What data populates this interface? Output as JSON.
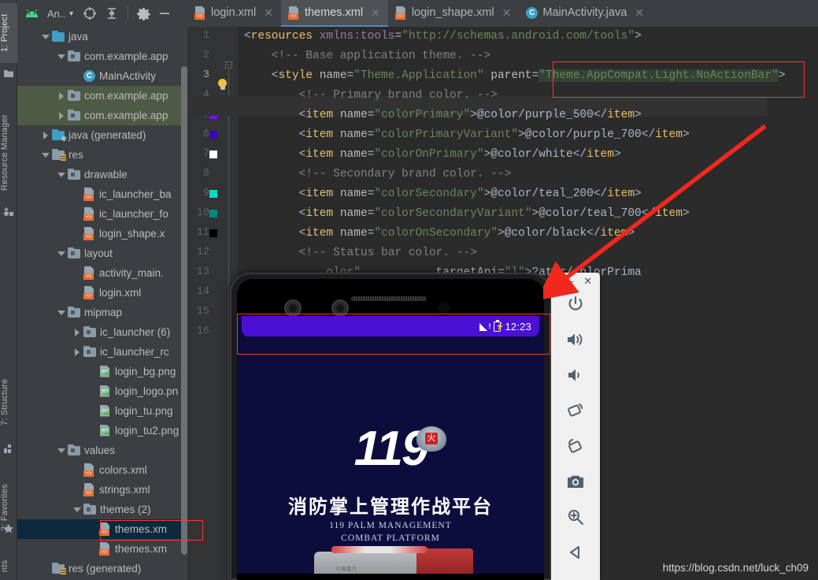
{
  "toolbar": {
    "app_selector": "An..",
    "icons": [
      "android-logo-icon",
      "dropdown-caret-icon",
      "target-icon",
      "collapse-icon",
      "settings-gear-icon",
      "minimize-icon"
    ]
  },
  "tabs": [
    {
      "label": "login.xml",
      "icon": "xml-file-icon",
      "active": false
    },
    {
      "label": "themes.xml",
      "icon": "xml-file-icon",
      "active": true
    },
    {
      "label": "login_shape.xml",
      "icon": "xml-file-icon",
      "active": false
    },
    {
      "label": "MainActivity.java",
      "icon": "java-class-icon",
      "active": false
    }
  ],
  "left_tool_strip": [
    {
      "label": "1: Project",
      "icon": "project-folder-icon",
      "active": true
    },
    {
      "label": "Resource Manager",
      "icon": "resource-manager-icon",
      "active": false
    },
    {
      "label": "7: Structure",
      "icon": "structure-icon",
      "active": false
    },
    {
      "label": "2: Favorites",
      "icon": "star-icon",
      "active": false
    },
    {
      "label": "nts",
      "icon": "",
      "active": false
    }
  ],
  "project_tree": [
    {
      "label": "java",
      "indent": 1,
      "arrow": "down",
      "icon": "folder-blue",
      "type": "folder",
      "state": "normal"
    },
    {
      "label": "com.example.app",
      "indent": 2,
      "arrow": "down",
      "icon": "folder-package",
      "type": "folder",
      "state": "normal"
    },
    {
      "label": "MainActivity",
      "indent": 3,
      "arrow": "none",
      "icon": "java-class-icon",
      "type": "class",
      "state": "normal"
    },
    {
      "label": "com.example.app",
      "indent": 2,
      "arrow": "right",
      "icon": "folder-package",
      "type": "folder",
      "state": "green"
    },
    {
      "label": "com.example.app",
      "indent": 2,
      "arrow": "right",
      "icon": "folder-package",
      "type": "folder",
      "state": "green"
    },
    {
      "label": "java (generated)",
      "indent": 1,
      "arrow": "right",
      "icon": "folder-generated",
      "type": "folder",
      "state": "normal"
    },
    {
      "label": "res",
      "indent": 1,
      "arrow": "down",
      "icon": "folder-res",
      "type": "folder",
      "state": "normal"
    },
    {
      "label": "drawable",
      "indent": 2,
      "arrow": "down",
      "icon": "folder-package",
      "type": "folder",
      "state": "normal"
    },
    {
      "label": "ic_launcher_ba",
      "indent": 3,
      "arrow": "none",
      "icon": "xml-file-icon",
      "type": "xml",
      "state": "normal"
    },
    {
      "label": "ic_launcher_fo",
      "indent": 3,
      "arrow": "none",
      "icon": "xml-file-icon",
      "type": "xml",
      "state": "normal"
    },
    {
      "label": "login_shape.x",
      "indent": 3,
      "arrow": "none",
      "icon": "xml-file-icon",
      "type": "xml",
      "state": "normal"
    },
    {
      "label": "layout",
      "indent": 2,
      "arrow": "down",
      "icon": "folder-package",
      "type": "folder",
      "state": "normal"
    },
    {
      "label": "activity_main.",
      "indent": 3,
      "arrow": "none",
      "icon": "xml-file-icon",
      "type": "xml",
      "state": "normal"
    },
    {
      "label": "login.xml",
      "indent": 3,
      "arrow": "none",
      "icon": "xml-file-icon",
      "type": "xml",
      "state": "normal"
    },
    {
      "label": "mipmap",
      "indent": 2,
      "arrow": "down",
      "icon": "folder-package",
      "type": "folder",
      "state": "normal"
    },
    {
      "label": "ic_launcher (6)",
      "indent": 3,
      "arrow": "right",
      "icon": "folder-package",
      "type": "folder",
      "state": "normal"
    },
    {
      "label": "ic_launcher_rc",
      "indent": 3,
      "arrow": "right",
      "icon": "folder-package",
      "type": "folder",
      "state": "normal"
    },
    {
      "label": "login_bg.png",
      "indent": 4,
      "arrow": "none",
      "icon": "image-file-icon",
      "type": "img",
      "state": "normal"
    },
    {
      "label": "login_logo.pn",
      "indent": 4,
      "arrow": "none",
      "icon": "image-file-icon",
      "type": "img",
      "state": "normal"
    },
    {
      "label": "login_tu.png",
      "indent": 4,
      "arrow": "none",
      "icon": "image-file-icon",
      "type": "img",
      "state": "normal"
    },
    {
      "label": "login_tu2.png",
      "indent": 4,
      "arrow": "none",
      "icon": "image-file-icon",
      "type": "img",
      "state": "normal"
    },
    {
      "label": "values",
      "indent": 2,
      "arrow": "down",
      "icon": "folder-package",
      "type": "folder",
      "state": "normal"
    },
    {
      "label": "colors.xml",
      "indent": 3,
      "arrow": "none",
      "icon": "xml-file-icon",
      "type": "xml",
      "state": "normal"
    },
    {
      "label": "strings.xml",
      "indent": 3,
      "arrow": "none",
      "icon": "xml-file-icon",
      "type": "xml",
      "state": "normal"
    },
    {
      "label": "themes (2)",
      "indent": 3,
      "arrow": "down",
      "icon": "folder-package",
      "type": "folder",
      "state": "normal"
    },
    {
      "label": "themes.xm",
      "indent": 4,
      "arrow": "none",
      "icon": "xml-file-icon",
      "type": "xml",
      "state": "blue"
    },
    {
      "label": "themes.xm",
      "indent": 4,
      "arrow": "none",
      "icon": "xml-file-icon",
      "type": "xml",
      "state": "normal"
    },
    {
      "label": "res (generated)",
      "indent": 1,
      "arrow": "none",
      "icon": "folder-res",
      "type": "folder",
      "state": "normal"
    }
  ],
  "editor": {
    "line_numbers": [
      "1",
      "2",
      "3",
      "4",
      "5",
      "6",
      "7",
      "8",
      "9",
      "10",
      "11",
      "12",
      "13",
      "14",
      "15",
      "16"
    ],
    "current_line": "3",
    "gutter_swatches": [
      {
        "line": "5",
        "color": "#7811f5"
      },
      {
        "line": "6",
        "color": "#3a06bb"
      },
      {
        "line": "7",
        "color": "#ffffff"
      },
      {
        "line": "9",
        "color": "#03dac5"
      },
      {
        "line": "10",
        "color": "#018786"
      },
      {
        "line": "11",
        "color": "#000000"
      }
    ],
    "lines": [
      {
        "n": 1,
        "segments": [
          {
            "t": "punc",
            "s": "<"
          },
          {
            "t": "tag",
            "s": "resources"
          },
          {
            "t": "txt",
            "s": " "
          },
          {
            "t": "ns",
            "s": "xmlns:tools"
          },
          {
            "t": "punc",
            "s": "="
          },
          {
            "t": "val",
            "s": "\"http://schemas.android.com/tools\""
          },
          {
            "t": "punc",
            "s": ">"
          }
        ]
      },
      {
        "n": 2,
        "segments": [
          {
            "t": "com",
            "s": "    <!-- Base application theme. -->"
          }
        ]
      },
      {
        "n": 3,
        "segments": [
          {
            "t": "punc",
            "s": "    <"
          },
          {
            "t": "tag",
            "s": "style"
          },
          {
            "t": "txt",
            "s": " "
          },
          {
            "t": "attr",
            "s": "name"
          },
          {
            "t": "punc",
            "s": "="
          },
          {
            "t": "val",
            "s": "\"Theme.Application\""
          },
          {
            "t": "txt",
            "s": " "
          },
          {
            "t": "attr",
            "s": "parent"
          },
          {
            "t": "punc",
            "s": "="
          },
          {
            "t": "valsel",
            "s": "\"Theme.AppCompat.Light.NoActionBar\""
          },
          {
            "t": "punc",
            "s": ">"
          }
        ]
      },
      {
        "n": 4,
        "segments": [
          {
            "t": "com",
            "s": "        <!-- Primary brand color. -->"
          }
        ]
      },
      {
        "n": 5,
        "segments": [
          {
            "t": "punc",
            "s": "        <"
          },
          {
            "t": "tag",
            "s": "item"
          },
          {
            "t": "txt",
            "s": " "
          },
          {
            "t": "attr",
            "s": "name"
          },
          {
            "t": "punc",
            "s": "="
          },
          {
            "t": "val",
            "s": "\"colorPrimary\""
          },
          {
            "t": "punc",
            "s": ">"
          },
          {
            "t": "txt",
            "s": "@color/purple_500"
          },
          {
            "t": "punc",
            "s": "</"
          },
          {
            "t": "tag",
            "s": "item"
          },
          {
            "t": "punc",
            "s": ">"
          }
        ]
      },
      {
        "n": 6,
        "segments": [
          {
            "t": "punc",
            "s": "        <"
          },
          {
            "t": "tag",
            "s": "item"
          },
          {
            "t": "txt",
            "s": " "
          },
          {
            "t": "attr",
            "s": "name"
          },
          {
            "t": "punc",
            "s": "="
          },
          {
            "t": "val",
            "s": "\"colorPrimaryVariant\""
          },
          {
            "t": "punc",
            "s": ">"
          },
          {
            "t": "txt",
            "s": "@color/purple_700"
          },
          {
            "t": "punc",
            "s": "</"
          },
          {
            "t": "tag",
            "s": "item"
          },
          {
            "t": "punc",
            "s": ">"
          }
        ]
      },
      {
        "n": 7,
        "segments": [
          {
            "t": "punc",
            "s": "        <"
          },
          {
            "t": "tag",
            "s": "item"
          },
          {
            "t": "txt",
            "s": " "
          },
          {
            "t": "attr",
            "s": "name"
          },
          {
            "t": "punc",
            "s": "="
          },
          {
            "t": "val",
            "s": "\"colorOnPrimary\""
          },
          {
            "t": "punc",
            "s": ">"
          },
          {
            "t": "txt",
            "s": "@color/white"
          },
          {
            "t": "punc",
            "s": "</"
          },
          {
            "t": "tag",
            "s": "item"
          },
          {
            "t": "punc",
            "s": ">"
          }
        ]
      },
      {
        "n": 8,
        "segments": [
          {
            "t": "com",
            "s": "        <!-- Secondary brand color. -->"
          }
        ]
      },
      {
        "n": 9,
        "segments": [
          {
            "t": "punc",
            "s": "        <"
          },
          {
            "t": "tag",
            "s": "item"
          },
          {
            "t": "txt",
            "s": " "
          },
          {
            "t": "attr",
            "s": "name"
          },
          {
            "t": "punc",
            "s": "="
          },
          {
            "t": "val",
            "s": "\"colorSecondary\""
          },
          {
            "t": "punc",
            "s": ">"
          },
          {
            "t": "txt",
            "s": "@color/teal_200"
          },
          {
            "t": "punc",
            "s": "</"
          },
          {
            "t": "tag",
            "s": "item"
          },
          {
            "t": "punc",
            "s": ">"
          }
        ]
      },
      {
        "n": 10,
        "segments": [
          {
            "t": "punc",
            "s": "        <"
          },
          {
            "t": "tag",
            "s": "item"
          },
          {
            "t": "txt",
            "s": " "
          },
          {
            "t": "attr",
            "s": "name"
          },
          {
            "t": "punc",
            "s": "="
          },
          {
            "t": "val",
            "s": "\"colorSecondaryVariant\""
          },
          {
            "t": "punc",
            "s": ">"
          },
          {
            "t": "txt",
            "s": "@color/teal_700"
          },
          {
            "t": "punc",
            "s": "</"
          },
          {
            "t": "tag",
            "s": "item"
          },
          {
            "t": "punc",
            "s": ">"
          }
        ]
      },
      {
        "n": 11,
        "segments": [
          {
            "t": "punc",
            "s": "        <"
          },
          {
            "t": "tag",
            "s": "item"
          },
          {
            "t": "txt",
            "s": " "
          },
          {
            "t": "attr",
            "s": "name"
          },
          {
            "t": "punc",
            "s": "="
          },
          {
            "t": "val",
            "s": "\"colorOnSecondary\""
          },
          {
            "t": "punc",
            "s": ">"
          },
          {
            "t": "txt",
            "s": "@color/black"
          },
          {
            "t": "punc",
            "s": "</"
          },
          {
            "t": "tag",
            "s": "item"
          },
          {
            "t": "punc",
            "s": ">"
          }
        ]
      },
      {
        "n": 12,
        "segments": [
          {
            "t": "com",
            "s": "        <!-- Status bar color. -->"
          }
        ]
      },
      {
        "n": 13,
        "segments": [
          {
            "t": "val",
            "s": "            olor\""
          },
          {
            "t": "txt",
            "s": "           "
          },
          {
            "t": "attr",
            "s": "targetApi"
          },
          {
            "t": "punc",
            "s": "="
          },
          {
            "t": "val",
            "s": "\"l\""
          },
          {
            "t": "punc",
            "s": ">"
          },
          {
            "t": "txt",
            "s": "?attr/colorPrima"
          }
        ]
      }
    ]
  },
  "emulator": {
    "window_buttons": [
      "minimize",
      "close"
    ],
    "status_bar": {
      "time": "12:23",
      "signal_icon": "signal-bars-icon",
      "battery_icon": "battery-charging-icon"
    },
    "app": {
      "number": "119",
      "cn_title": "消防掌上管理作战平台",
      "en_title_line1": "119 PALM MANAGEMENT",
      "en_title_line2": "COMBAT PLATFORM",
      "truck_text": "中国重汽"
    },
    "side_buttons": [
      {
        "name": "power-icon",
        "label": "Power"
      },
      {
        "name": "volume-up-icon",
        "label": "Volume Up"
      },
      {
        "name": "volume-down-icon",
        "label": "Volume Down"
      },
      {
        "name": "rotate-left-icon",
        "label": "Rotate Left"
      },
      {
        "name": "rotate-right-icon",
        "label": "Rotate Right"
      },
      {
        "name": "camera-icon",
        "label": "Screenshot"
      },
      {
        "name": "zoom-icon",
        "label": "Zoom"
      },
      {
        "name": "back-icon",
        "label": "Back"
      }
    ]
  },
  "watermark": "https://blog.csdn.net/luck_ch09"
}
